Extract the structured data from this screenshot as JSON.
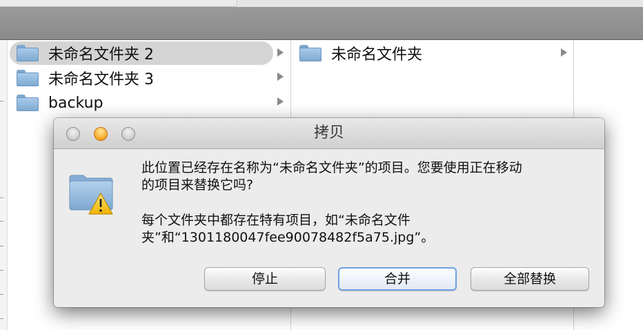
{
  "browser": {
    "column1": [
      {
        "label": "未命名文件夹 2",
        "selected": true
      },
      {
        "label": "未命名文件夹 3",
        "selected": false
      },
      {
        "label": "backup",
        "selected": false
      }
    ],
    "column2": [
      {
        "label": "未命名文件夹",
        "selected": false
      }
    ]
  },
  "dialog": {
    "title": "拷贝",
    "message_line1": "此位置已经存在名称为“未命名文件夹”的项目。您要使用正在移动",
    "message_line2": "的项目来替换它吗?",
    "info_line1": "每个文件夹中都存在特有项目，如“未命名文件",
    "info_line2": "夹”和“1301180047fee90078482f5a75.jpg”。",
    "icon": "folder-warning-icon",
    "buttons": {
      "stop": "停止",
      "merge": "合并",
      "replace_all": "全部替换"
    }
  },
  "colors": {
    "accent_focus": "#6fa1e0",
    "warning": "#f5c518",
    "folder": "#8fb6de"
  }
}
